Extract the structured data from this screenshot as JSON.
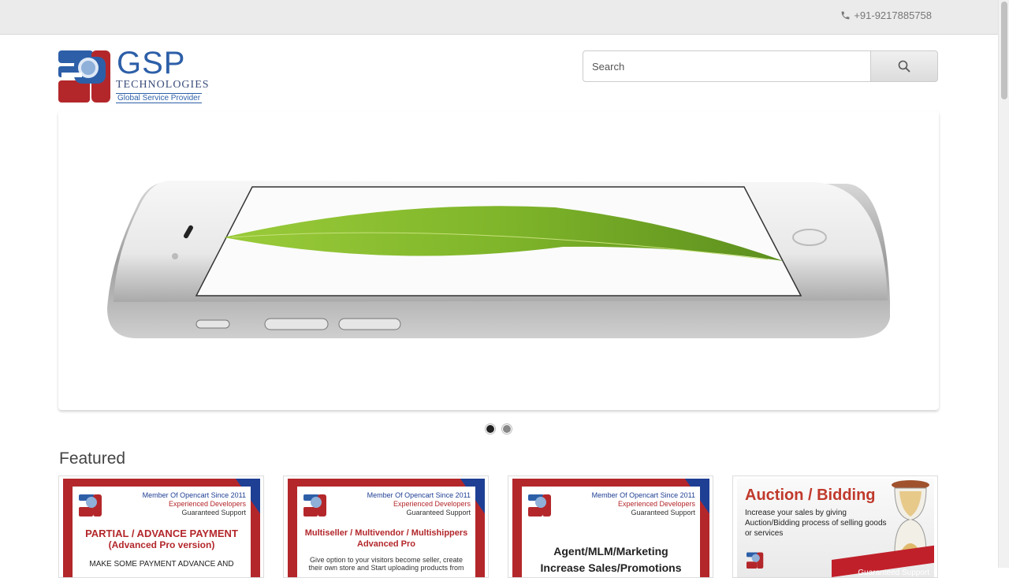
{
  "topbar": {
    "phone": "+91-9217885758",
    "phone_icon": "phone-icon"
  },
  "logo": {
    "name": "GSP",
    "line1": "TECHNOLOGIES",
    "line2": "Global Service Provider"
  },
  "search": {
    "placeholder": "Search",
    "button_icon": "search-icon"
  },
  "slideshow": {
    "active_index": 0,
    "slide_count": 2
  },
  "featured": {
    "title": "Featured",
    "products": [
      {
        "member": "Member Of Opencart Since 2011",
        "exp": "Experienced Developers",
        "support": "Guaranteed Support",
        "title": "PARTIAL / ADVANCE PAYMENT",
        "subtitle": "(Advanced Pro version)",
        "desc": "MAKE SOME PAYMENT ADVANCE AND"
      },
      {
        "member": "Member Of Opencart Since 2011",
        "exp": "Experienced Developers",
        "support": "Guaranteed Support",
        "title": "Multiseller / Multivendor / Multishippers",
        "subtitle": "Advanced Pro",
        "desc": "Give option to your visitors become seller, create their own store and  Start uploading products from"
      },
      {
        "member": "Member Of Opencart Since 2011",
        "exp": "Experienced Developers",
        "support": "Guaranteed Support",
        "title": "Agent/MLM/Marketing",
        "subtitle": "Increase Sales/Promotions",
        "desc": ""
      },
      {
        "title": "Auction / Bidding",
        "desc": "Increase your sales by giving Auction/Bidding process of selling goods or services",
        "support": "Guaranteed Support"
      }
    ]
  },
  "colors": {
    "brand_blue": "#2d5fa8",
    "brand_red": "#b3272b",
    "topbar_bg": "#ebebeb"
  }
}
